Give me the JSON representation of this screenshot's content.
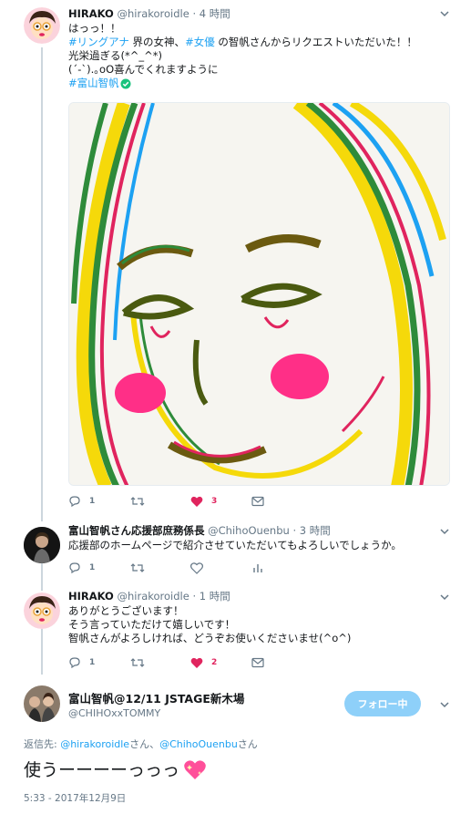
{
  "tweets": [
    {
      "name": "HIRAKO",
      "handle": "@hirakoroidle",
      "dot": "·",
      "time": "4 時間",
      "line1": "はっっ！！",
      "line2_tag1": "#リングアナ",
      "line2_mid": " 界の女神、",
      "line2_tag2": "#女優",
      "line2_end": " の智帆さんからリクエストいただいた！！",
      "line3": "光栄過ぎる(*^_^*)",
      "line4": "(´-`).｡oO喜んでくれますように",
      "line5_tag": "#富山智帆",
      "reply_count": "1",
      "retweet_count": "",
      "like_count": "3",
      "liked": true
    },
    {
      "name": "富山智帆さん応援部庶務係長",
      "handle": "@ChihoOuenbu",
      "dot": "·",
      "time": "3 時間",
      "text": "応援部のホームページで紹介させていただいてもよろしいでしょうか。",
      "reply_count": "1",
      "retweet_count": "",
      "like_count": ""
    },
    {
      "name": "HIRAKO",
      "handle": "@hirakoroidle",
      "dot": "·",
      "time": "1 時間",
      "line1": "ありがとうございます！",
      "line2": "そう言っていただけて嬉しいです！",
      "line3": "智帆さんがよろしければ、どうぞお使いくださいませ(^o^)",
      "reply_count": "1",
      "retweet_count": "",
      "like_count": "2",
      "liked": true
    }
  ],
  "main": {
    "name": "富山智帆@12/11 JSTAGE新木場",
    "handle": "@CHIHOxxTOMMY",
    "follow_label": "フォロー中",
    "reply_prefix": "返信先: ",
    "reply_user1": "@hirakoroidle",
    "reply_sep1": "さん、",
    "reply_user2": "@ChihoOuenbu",
    "reply_sep2": "さん",
    "text": "使うーーーーっっっ",
    "timestamp": "5:33 - 2017年12月9日"
  },
  "icons": {
    "reply": "reply-icon",
    "retweet": "retweet-icon",
    "like": "heart-icon",
    "dm": "envelope-icon",
    "analytics": "bar-chart-icon",
    "caret": "chevron-down-icon",
    "verified": "verified-icon",
    "emoji": "sparkling-heart-icon"
  },
  "colors": {
    "accent": "#1da1f2",
    "like": "#e0245e",
    "muted": "#657786",
    "follow": "#8ed0f9"
  }
}
